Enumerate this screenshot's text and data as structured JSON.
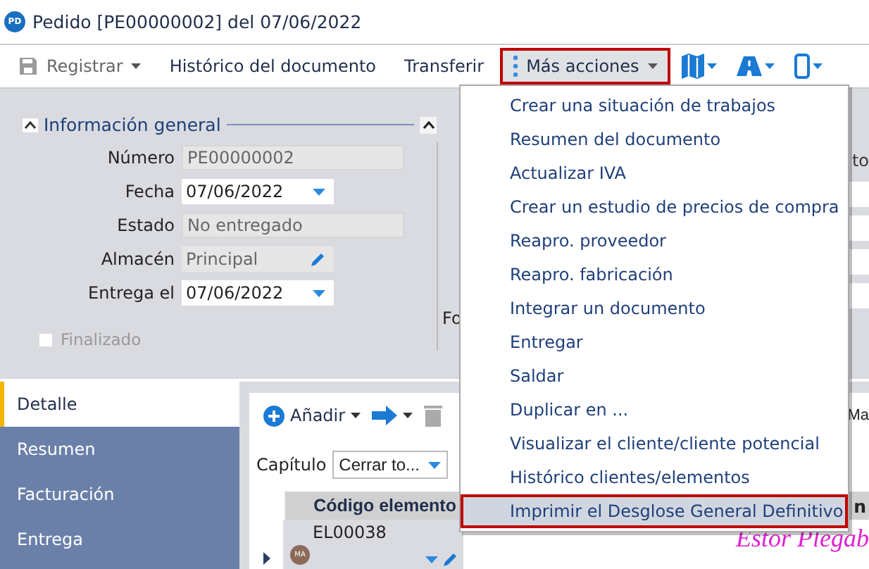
{
  "window": {
    "title": "Pedido [PE00000002] del 07/06/2022",
    "badge": "PD"
  },
  "toolbar": {
    "items": [
      {
        "label": "Registrar",
        "kind": "save",
        "caret": true
      },
      {
        "label": "Histórico del documento",
        "kind": "text",
        "caret": false
      },
      {
        "label": "Transferir",
        "kind": "text",
        "caret": false
      },
      {
        "label": "Más acciones",
        "kind": "more",
        "caret": true,
        "selected": true
      }
    ],
    "icons": [
      {
        "kind": "map"
      },
      {
        "kind": "road"
      },
      {
        "kind": "phone"
      }
    ]
  },
  "general": {
    "title": "Información general",
    "expanded": true,
    "fields": [
      {
        "label": "Número",
        "value": "PE00000002",
        "kind": "readonly"
      },
      {
        "label": "Fecha",
        "value": "07/06/2022",
        "kind": "date"
      },
      {
        "label": "Estado",
        "value": "No entregado",
        "kind": "readonly"
      },
      {
        "label": "Almacén",
        "value": "Principal",
        "kind": "edit"
      },
      {
        "label": "Entrega el",
        "value": "07/06/2022",
        "kind": "date"
      }
    ],
    "checkbox": {
      "label": "Finalizado",
      "checked": false,
      "disabled": true
    }
  },
  "right_panel": {
    "label_1": "Fo",
    "label_2": "to"
  },
  "tabs": [
    {
      "label": "Detalle",
      "selected": true
    },
    {
      "label": "Resumen",
      "selected": false
    },
    {
      "label": "Facturación",
      "selected": false
    },
    {
      "label": "Entrega",
      "selected": false
    }
  ],
  "detail": {
    "add": "Añadir",
    "chapter_label": "Capítulo",
    "chapter_value": "Cerrar to...",
    "column_label": "Ma",
    "columns": [
      "Código elemento",
      "n"
    ],
    "rows": [
      {
        "code": "EL00038",
        "avatar": "MA",
        "description": "Estor Plegab"
      }
    ]
  },
  "menu": {
    "items": [
      {
        "label": "Crear una situación de trabajos",
        "selected": false
      },
      {
        "label": "Resumen del documento",
        "selected": false
      },
      {
        "label": "Actualizar IVA",
        "selected": false
      },
      {
        "label": "Crear un estudio de precios de compra",
        "selected": false
      },
      {
        "label": "Reapro. proveedor",
        "selected": false
      },
      {
        "label": "Reapro. fabricación",
        "selected": false
      },
      {
        "label": "Integrar un documento",
        "selected": false
      },
      {
        "label": "Entregar",
        "selected": false
      },
      {
        "label": "Saldar",
        "selected": false
      },
      {
        "label": "Duplicar en ...",
        "selected": false
      },
      {
        "label": "Visualizar el cliente/cliente potencial",
        "selected": false
      },
      {
        "label": "Histórico clientes/elementos",
        "selected": false
      },
      {
        "label": "Imprimir el Desglose General Definitivo",
        "selected": true
      }
    ]
  }
}
